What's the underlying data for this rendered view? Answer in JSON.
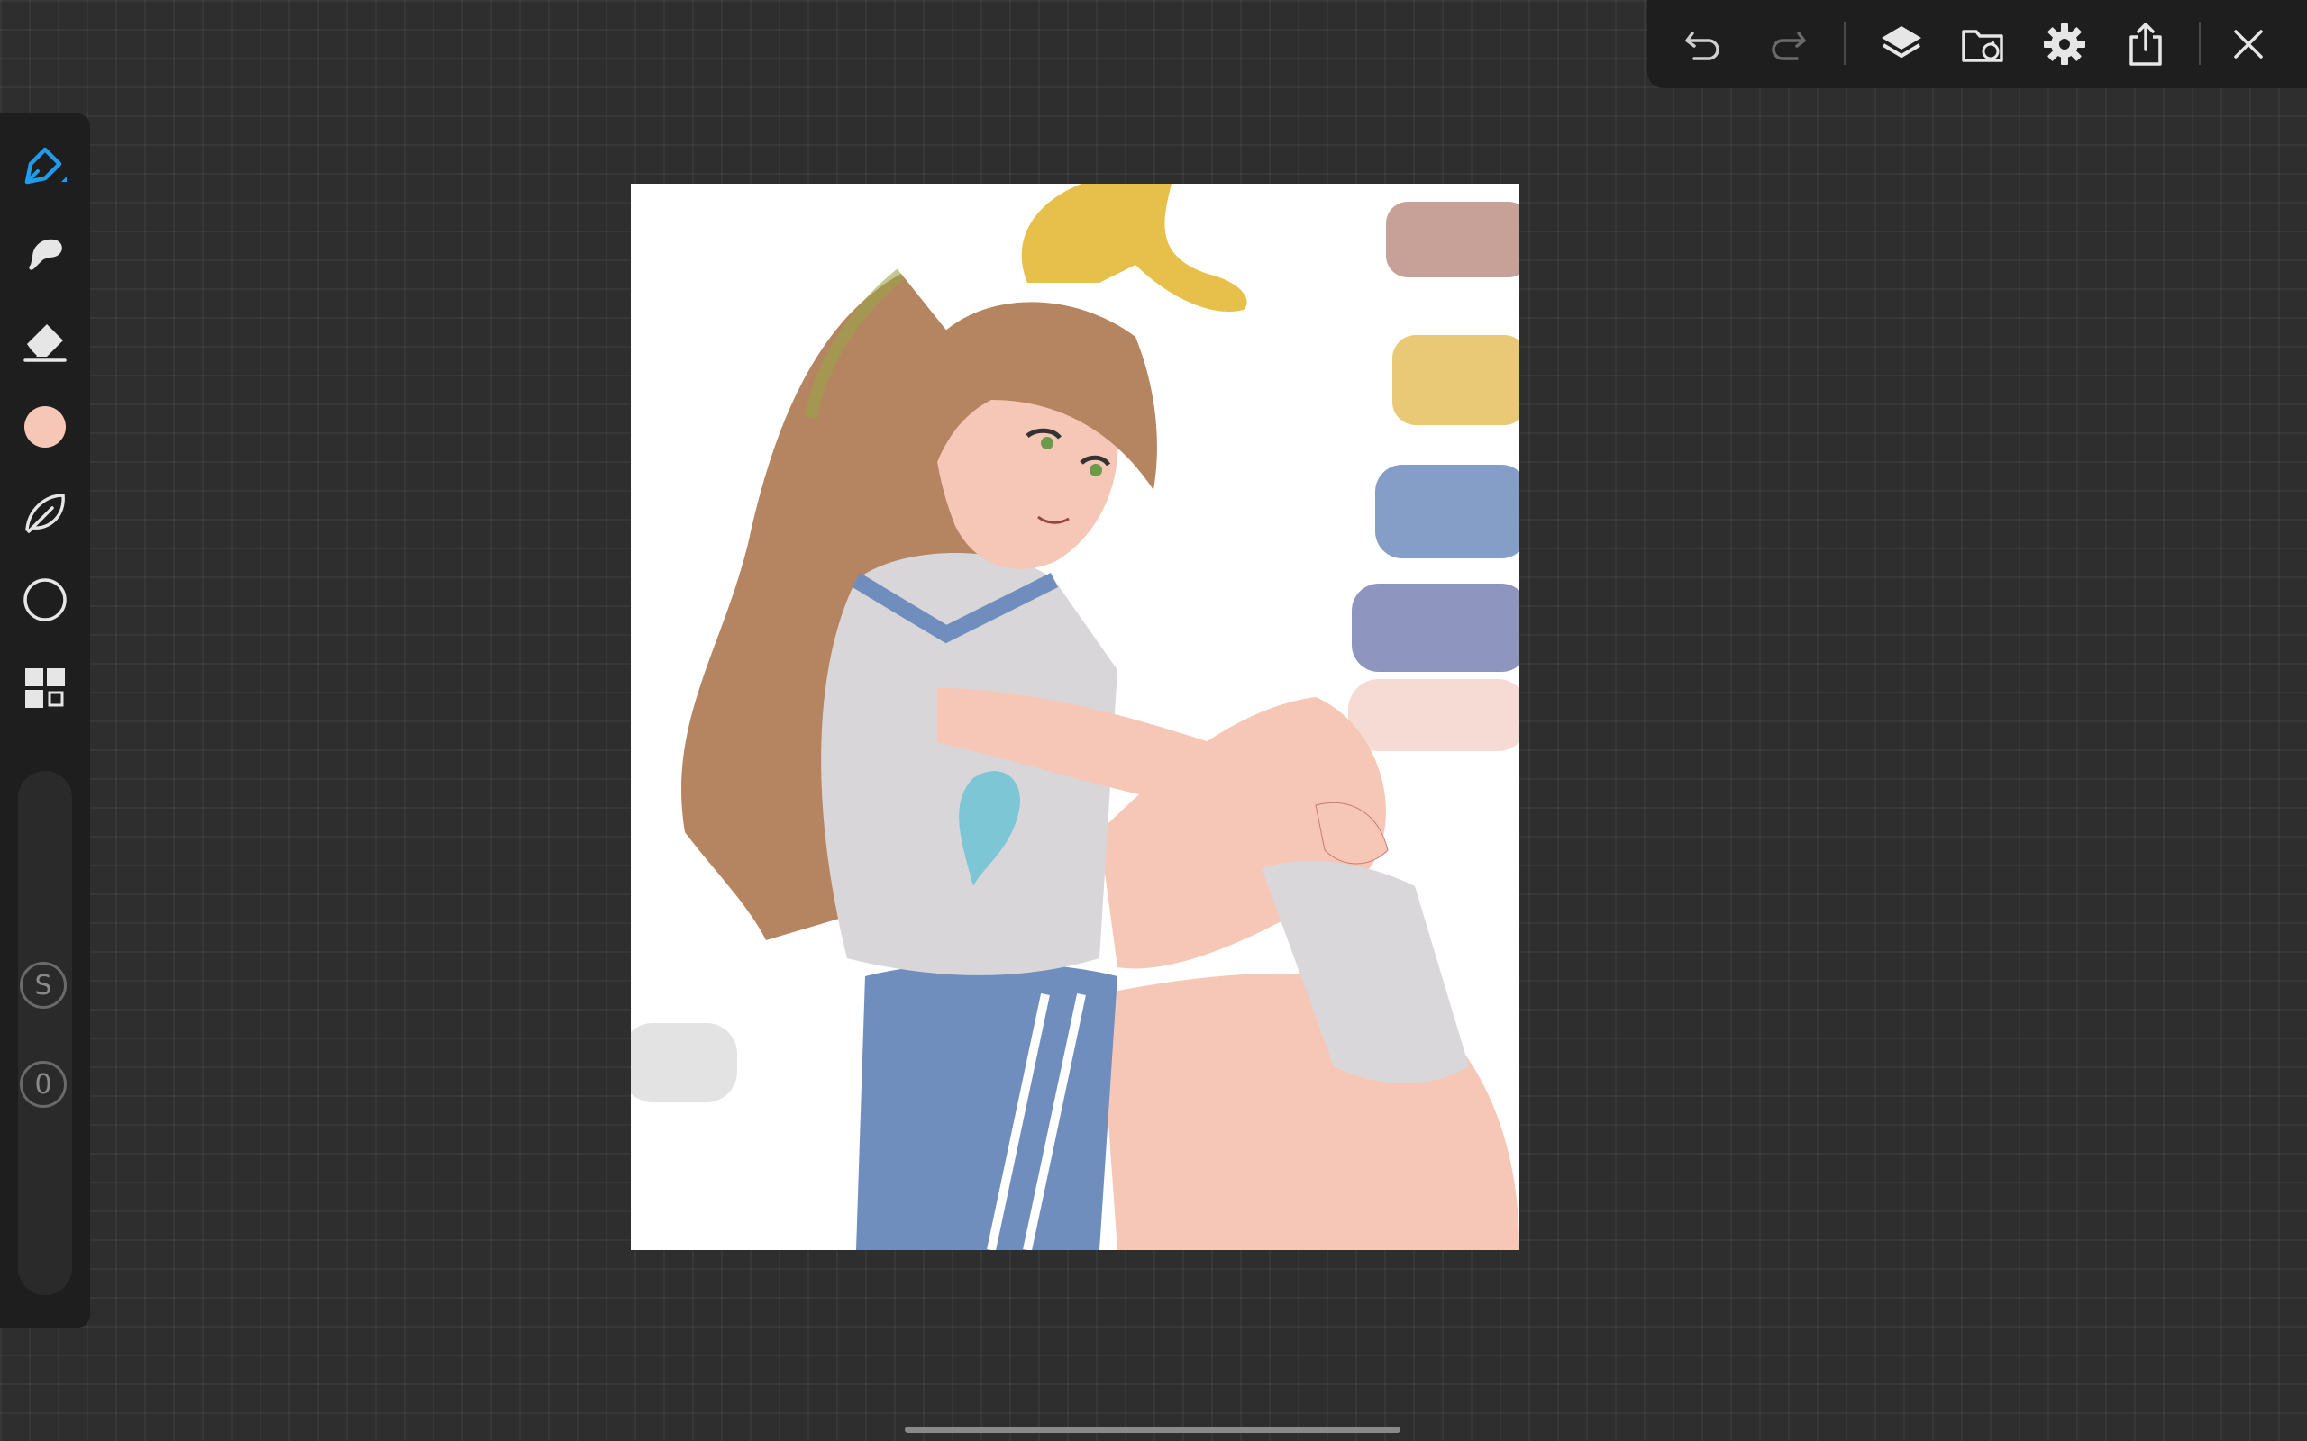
{
  "toolbar": {
    "undo_icon": "undo-icon",
    "redo_icon": "redo-icon",
    "layers_icon": "layers-icon",
    "gallery_icon": "gallery-icon",
    "settings_icon": "gear-icon",
    "share_icon": "share-icon",
    "close_icon": "close-icon"
  },
  "sidebar": {
    "tools": [
      {
        "name": "pen",
        "icon": "pen-icon",
        "active": true
      },
      {
        "name": "smudge",
        "icon": "smudge-icon"
      },
      {
        "name": "eraser",
        "icon": "eraser-icon"
      },
      {
        "name": "color",
        "icon": "color-swatch",
        "color": "#f6c7b6"
      },
      {
        "name": "selection",
        "icon": "leaf-lasso-icon"
      },
      {
        "name": "shape",
        "icon": "circle-icon"
      },
      {
        "name": "more",
        "icon": "grid-icon"
      }
    ],
    "size_label": "S",
    "opacity_label": "0"
  },
  "colors": {
    "accent": "#1e9cf0",
    "current_color": "#f6c7b6",
    "swatches": [
      "#b98a7e",
      "#e6bf5e",
      "#6f8dbd",
      "#7a82b4",
      "#f4d7cf",
      "#e0e0e0"
    ]
  }
}
